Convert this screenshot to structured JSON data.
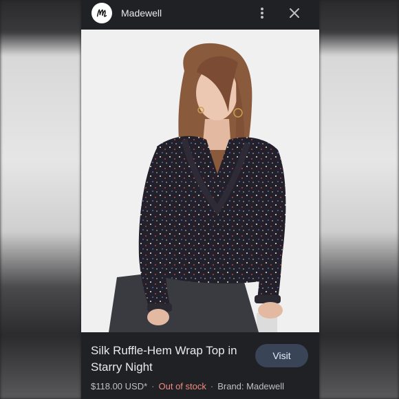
{
  "header": {
    "site_name": "Madewell",
    "logo_icon": "madewell-m-logo-icon",
    "more_icon": "more-vertical-icon",
    "close_icon": "close-icon"
  },
  "image": {
    "subject": "product-photo"
  },
  "product": {
    "title": "Silk Ruffle-Hem Wrap Top in Starry Night",
    "visit_label": "Visit",
    "price": "$118.00 USD*",
    "separator": "·",
    "stock_status": "Out of stock",
    "brand": "Brand: Madewell"
  },
  "colors": {
    "panel_bg": "#202124",
    "stock_status": "#f28b82",
    "visit_button_bg": "#394457"
  }
}
